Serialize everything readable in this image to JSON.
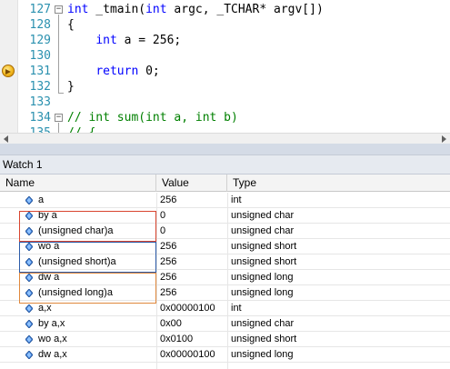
{
  "editor": {
    "lines": [
      {
        "number": "127",
        "parts": [
          {
            "t": "int",
            "k": "kw"
          },
          {
            "t": " _tmain(",
            "k": ""
          },
          {
            "t": "int",
            "k": "kw"
          },
          {
            "t": " argc, _TCHAR* argv[])",
            "k": ""
          }
        ]
      },
      {
        "number": "128",
        "parts": [
          {
            "t": "{",
            "k": ""
          }
        ]
      },
      {
        "number": "129",
        "parts": [
          {
            "t": "    ",
            "k": ""
          },
          {
            "t": "int",
            "k": "kw"
          },
          {
            "t": " a = 256;",
            "k": ""
          }
        ]
      },
      {
        "number": "130",
        "parts": []
      },
      {
        "number": "131",
        "parts": [
          {
            "t": "    ",
            "k": ""
          },
          {
            "t": "return",
            "k": "kw"
          },
          {
            "t": " 0;",
            "k": ""
          }
        ]
      },
      {
        "number": "132",
        "parts": [
          {
            "t": "}",
            "k": ""
          }
        ]
      },
      {
        "number": "133",
        "parts": []
      },
      {
        "number": "134",
        "parts": [
          {
            "t": "// int sum(int a, int b)",
            "k": "cm"
          }
        ]
      },
      {
        "number": "135",
        "parts": [
          {
            "t": "// {",
            "k": "cm"
          }
        ]
      }
    ]
  },
  "watch": {
    "title": "Watch 1",
    "columns": {
      "name": "Name",
      "value": "Value",
      "type": "Type"
    },
    "rows": [
      {
        "name": "a",
        "value": "256",
        "type": "int"
      },
      {
        "name": "by a",
        "value": "0",
        "type": "unsigned char"
      },
      {
        "name": "(unsigned char)a",
        "value": "0",
        "type": "unsigned char"
      },
      {
        "name": "wo a",
        "value": "256",
        "type": "unsigned short"
      },
      {
        "name": "(unsigned short)a",
        "value": "256",
        "type": "unsigned short"
      },
      {
        "name": "dw a",
        "value": "256",
        "type": "unsigned long"
      },
      {
        "name": "(unsigned long)a",
        "value": "256",
        "type": "unsigned long"
      },
      {
        "name": "a,x",
        "value": "0x00000100",
        "type": "int"
      },
      {
        "name": "by a,x",
        "value": "0x00",
        "type": "unsigned char"
      },
      {
        "name": "wo a,x",
        "value": "0x0100",
        "type": "unsigned short"
      },
      {
        "name": "dw a,x",
        "value": "0x00000100",
        "type": "unsigned long"
      }
    ]
  },
  "colors": {
    "keyword": "#0000ff",
    "comment": "#008000",
    "line_number": "#2b91af",
    "highlight_red": "#d9452f",
    "highlight_blue": "#2c5ba8",
    "highlight_orange": "#e0883c"
  },
  "icons": {
    "breakpoint": "current-statement-arrow-icon",
    "watch_item": "variable-icon"
  }
}
